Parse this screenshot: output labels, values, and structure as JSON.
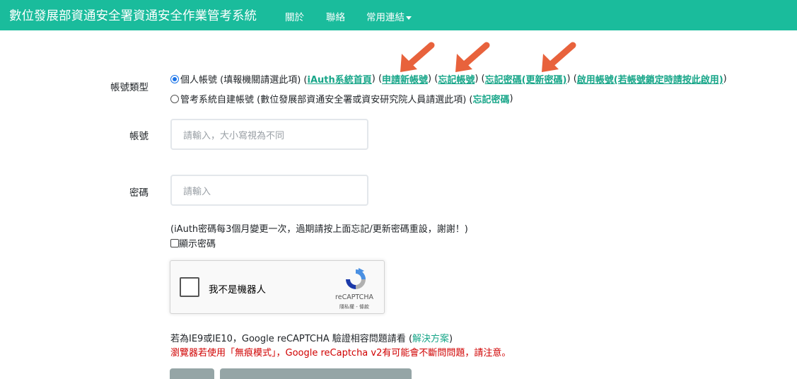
{
  "navbar": {
    "brand": "數位發展部資通安全署資通安全作業管考系統",
    "items": [
      "關於",
      "聯絡",
      "常用連結"
    ]
  },
  "account_type": {
    "label": "帳號類型",
    "option1": {
      "text": "個人帳號 (填報機關請選此項) (",
      "link_iauth": "iAuth系統首頁",
      "sep1": ") (",
      "link_apply": "申請新帳號",
      "sep2": ") (",
      "link_forgot_account": "忘記帳號",
      "sep3": ") (",
      "link_forgot_password": "忘記密碼(更新密碼)",
      "sep4": ") (",
      "link_enable": "啟用帳號(若帳號鎖定時請按此啟用)",
      "end": ")"
    },
    "option2": {
      "text": "管考系統自建帳號 (數位發展部資通安全署或資安研究院人員請選此項) (",
      "link_forgot_password": "忘記密碼",
      "end": ")"
    }
  },
  "account": {
    "label": "帳號",
    "placeholder": "請輸入，大小寫視為不同"
  },
  "password": {
    "label": "密碼",
    "placeholder": "請輸入"
  },
  "password_note": "(iAuth密碼每3個月變更一次，過期請按上面忘記/更新密碼重設，謝謝！)",
  "show_password": "顯示密碼",
  "recaptcha": {
    "label": "我不是機器人",
    "brand": "reCAPTCHA",
    "links": "隱私權 - 條款"
  },
  "ie_note": {
    "text": "若為IE9或IE10，Google reCAPTCHA 驗證相容問題請看 (",
    "link": "解決方案",
    "end": ")"
  },
  "warning": "瀏覽器若使用「無痕模式」，Google reCaptcha v2有可能會不斷問問題，請注意。",
  "colors": {
    "navbar": "#1abc9c",
    "link": "#18a689",
    "arrow": "#e8623c",
    "warning": "#d00000",
    "button": "#95a5a6"
  }
}
